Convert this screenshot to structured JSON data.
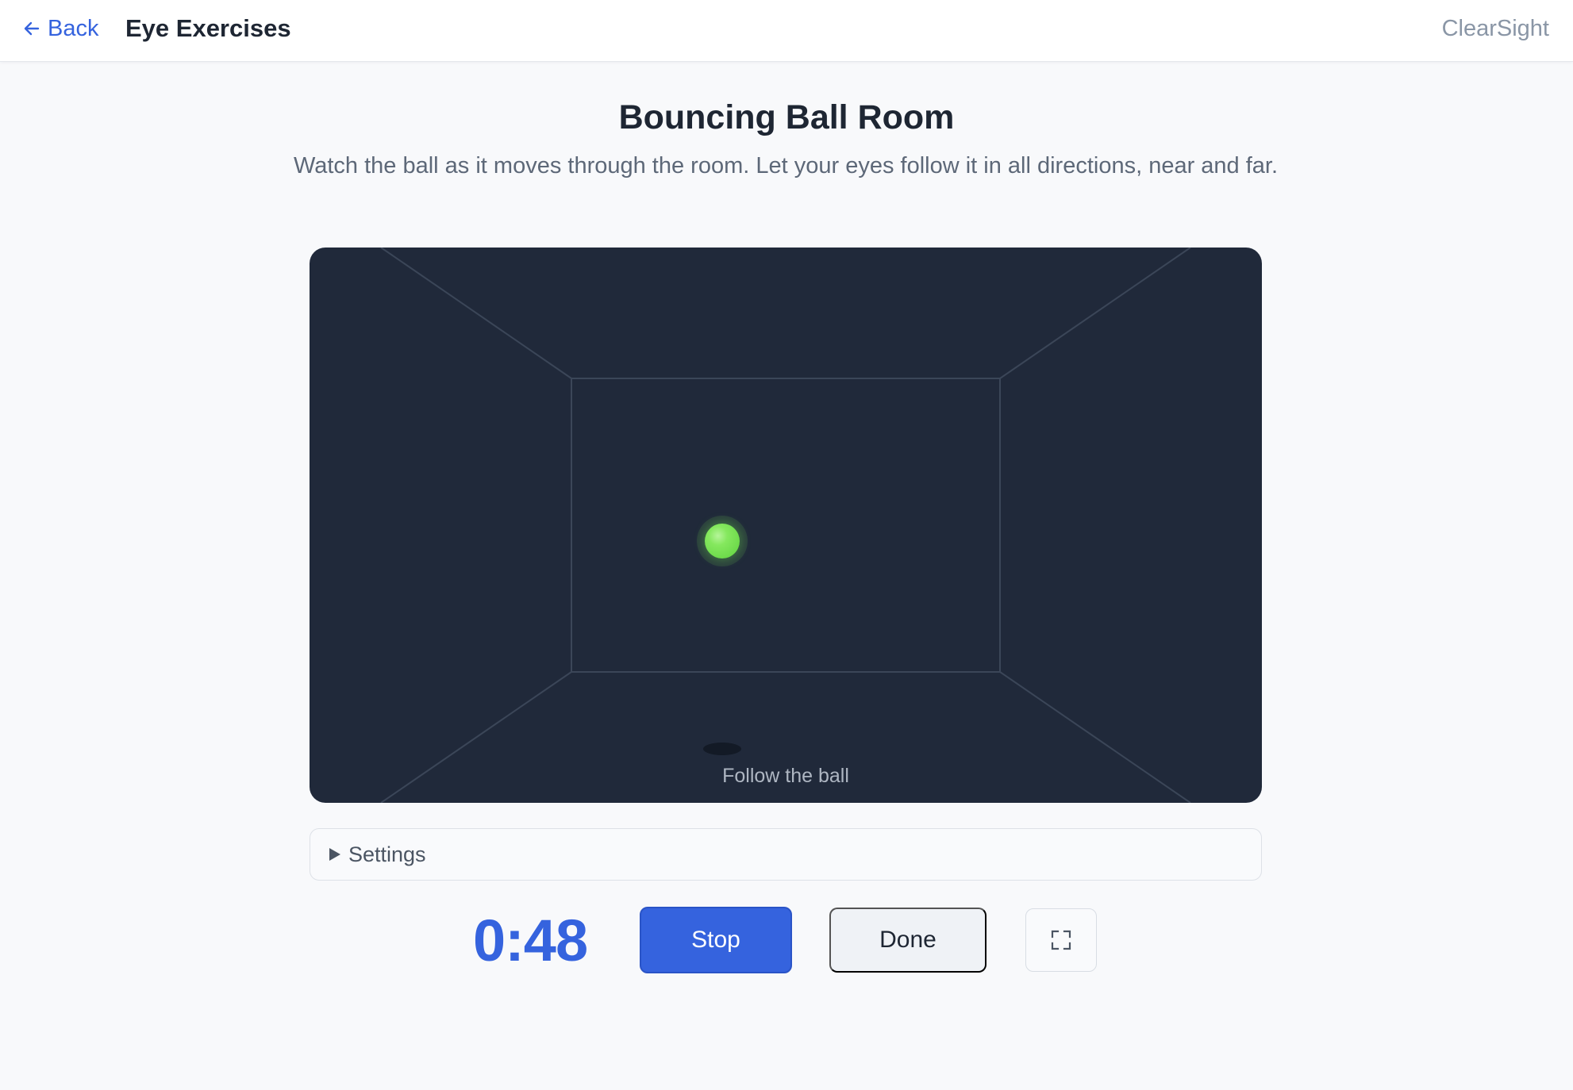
{
  "header": {
    "back_label": "Back",
    "title": "Eye Exercises",
    "brand": "ClearSight"
  },
  "exercise": {
    "title": "Bouncing Ball Room",
    "description": "Watch the ball as it moves through the room. Let your eyes follow it in all directions, near and far.",
    "hint": "Follow the ball"
  },
  "settings": {
    "label": "Settings",
    "expanded": false
  },
  "controls": {
    "timer": "0:48",
    "stop_label": "Stop",
    "done_label": "Done",
    "fullscreen_icon": "fullscreen-icon"
  },
  "colors": {
    "accent": "#3563de",
    "room_bg": "#20293a",
    "ball": "#85e85e"
  }
}
